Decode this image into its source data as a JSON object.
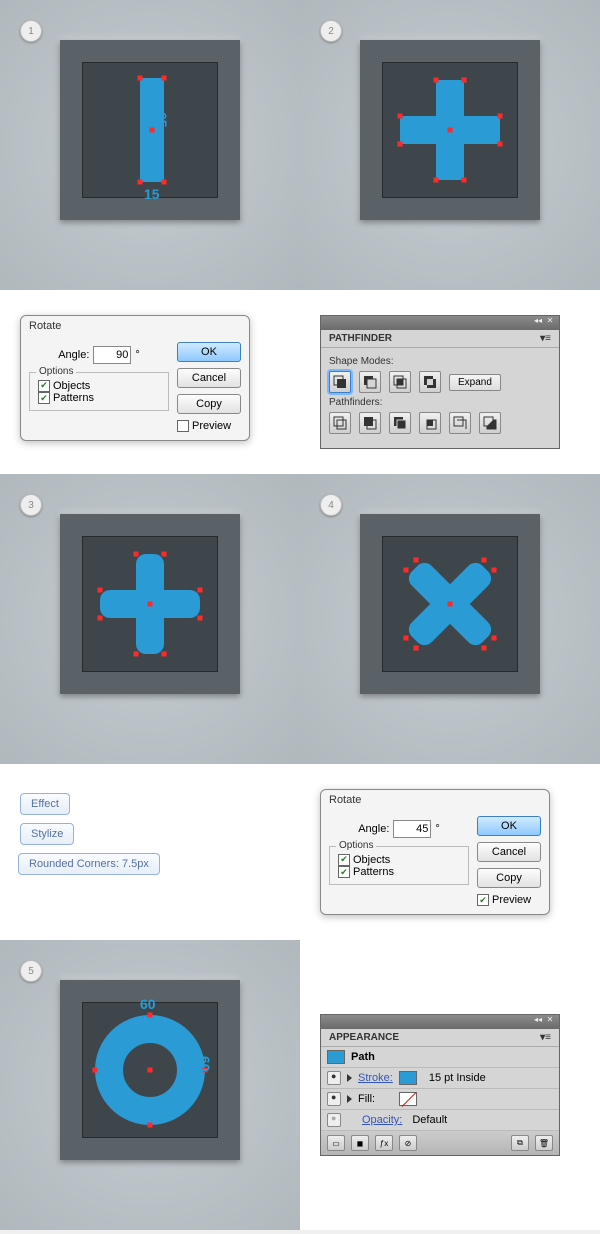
{
  "steps": [
    "1",
    "2",
    "3",
    "4",
    "5"
  ],
  "dim": {
    "r15": "15",
    "r65": "65",
    "c60a": "60",
    "c60b": "60"
  },
  "rotate1": {
    "title": "Rotate",
    "angle_label": "Angle:",
    "angle_value": "90",
    "degree": "°",
    "options_legend": "Options",
    "objects": "Objects",
    "patterns": "Patterns",
    "ok": "OK",
    "cancel": "Cancel",
    "copy": "Copy",
    "preview": "Preview"
  },
  "rotate2": {
    "title": "Rotate",
    "angle_label": "Angle:",
    "angle_value": "45",
    "degree": "°",
    "options_legend": "Options",
    "objects": "Objects",
    "patterns": "Patterns",
    "ok": "OK",
    "cancel": "Cancel",
    "copy": "Copy",
    "preview": "Preview"
  },
  "pathfinder": {
    "title": "PATHFINDER",
    "shape_modes": "Shape Modes:",
    "pathfinders": "Pathfinders:",
    "expand": "Expand"
  },
  "effects": {
    "effect": "Effect",
    "stylize": "Stylize",
    "rounded": "Rounded Corners: 7.5px"
  },
  "appearance": {
    "title": "APPEARANCE",
    "path": "Path",
    "stroke": "Stroke:",
    "stroke_val": "15 pt  Inside",
    "fill": "Fill:",
    "opacity": "Opacity:",
    "opacity_val": "Default"
  }
}
